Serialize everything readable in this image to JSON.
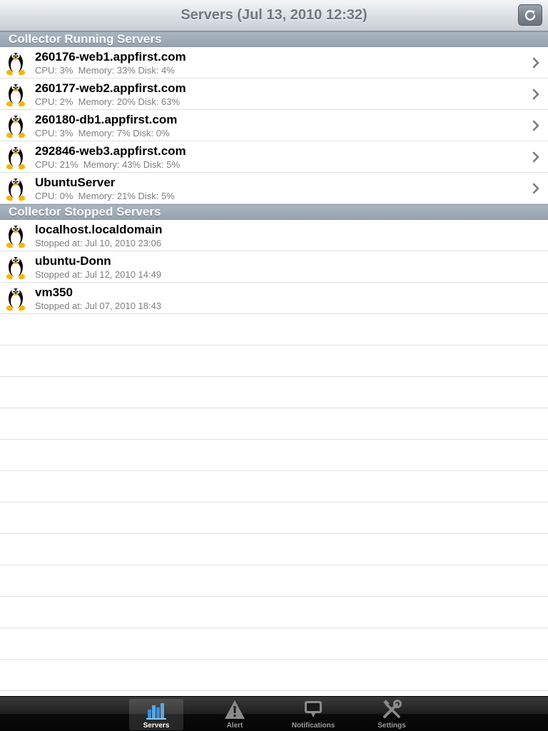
{
  "navbar": {
    "title": "Servers (Jul 13, 2010 12:32)",
    "refresh_icon": "refresh-icon"
  },
  "sections": {
    "running": {
      "header": "Collector Running Servers",
      "servers": [
        {
          "name": "260176-web1.appfirst.com",
          "detail": "CPU: 3%  Memory: 33% Disk: 4%"
        },
        {
          "name": "260177-web2.appfirst.com",
          "detail": "CPU: 2%  Memory: 20% Disk: 63%"
        },
        {
          "name": "260180-db1.appfirst.com",
          "detail": "CPU: 3%  Memory: 7% Disk: 0%"
        },
        {
          "name": "292846-web3.appfirst.com",
          "detail": "CPU: 21%  Memory: 43% Disk: 5%"
        },
        {
          "name": "UbuntuServer",
          "detail": "CPU: 0%  Memory: 21% Disk: 5%"
        }
      ]
    },
    "stopped": {
      "header": "Collector Stopped Servers",
      "servers": [
        {
          "name": "localhost.localdomain",
          "detail": "Stopped at: Jul 10, 2010 23:06"
        },
        {
          "name": "ubuntu-Donn",
          "detail": "Stopped at: Jul 12, 2010 14:49"
        },
        {
          "name": "vm350",
          "detail": "Stopped at: Jul 07, 2010 18:43"
        }
      ]
    }
  },
  "tabbar": {
    "tabs": [
      {
        "label": "Servers",
        "icon": "bar-chart-icon",
        "selected": true
      },
      {
        "label": "Alert",
        "icon": "warning-icon",
        "selected": false
      },
      {
        "label": "Notifications",
        "icon": "speech-bubble-icon",
        "selected": false
      },
      {
        "label": "Settings",
        "icon": "tools-icon",
        "selected": false
      }
    ]
  },
  "colors": {
    "section_header": "#a0acb8",
    "detail_text": "#7f7f7f",
    "tab_selected_icon": "#4a9ad6"
  }
}
